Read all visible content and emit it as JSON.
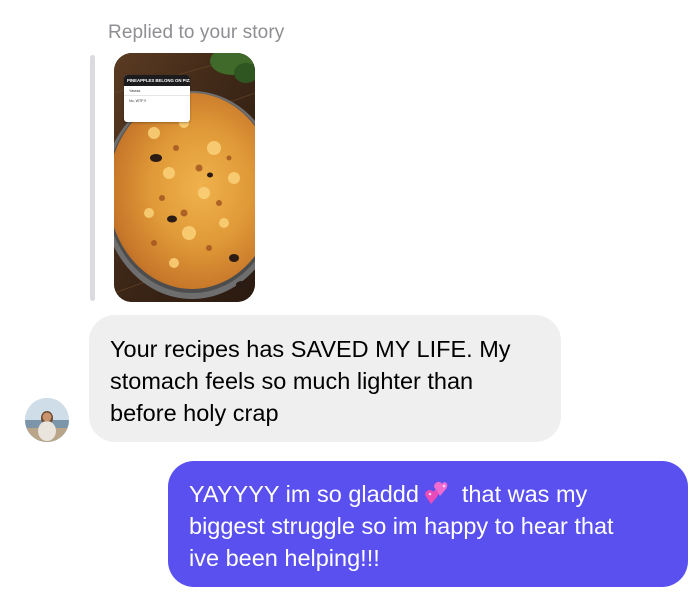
{
  "reply_header": {
    "label": "Replied to your story"
  },
  "story": {
    "poll_question": "PINEAPPLES BELONG ON PIZZA",
    "poll_options": [
      "Yassss",
      "No, WTF?!"
    ]
  },
  "incoming_message": {
    "lines": [
      "Your recipes has SAVED MY LIFE. My",
      "stomach feels so much lighter than",
      "before holy crap"
    ]
  },
  "outgoing_message": {
    "line1_before_emoji": "YAYYYY im so gladdd",
    "emoji": "two-hearts-icon",
    "line1_after_emoji": "that was my",
    "line2": "biggest struggle so im happy to hear that",
    "line3": "ive been helping!!!"
  },
  "colors": {
    "incoming_bubble": "#efeff0",
    "outgoing_bubble": "#5950ef",
    "secondary_text": "#8e8e93",
    "reply_bar": "#dcdce0"
  }
}
